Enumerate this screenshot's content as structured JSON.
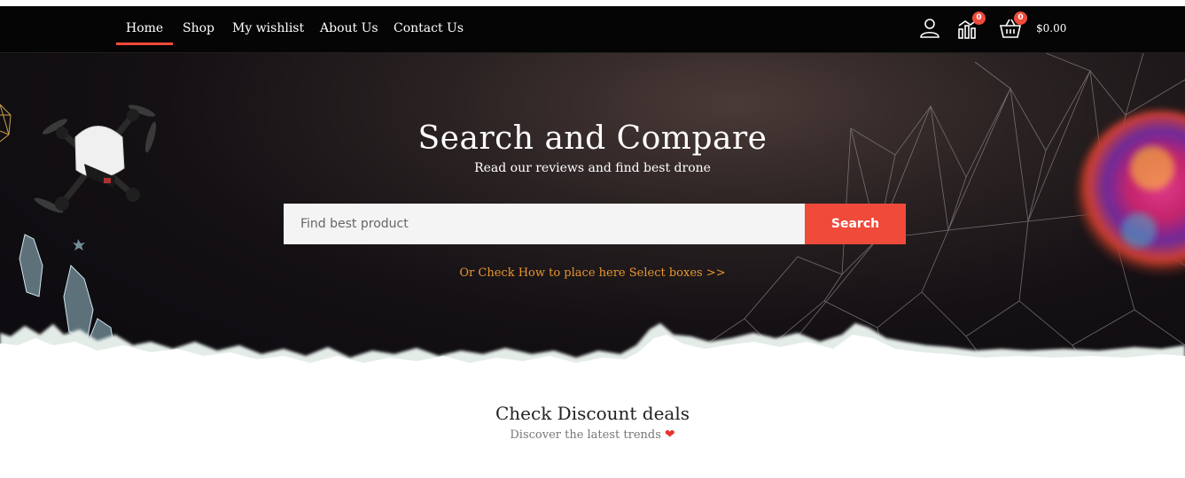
{
  "nav": {
    "items": [
      {
        "label": "Home",
        "active": true
      },
      {
        "label": "Shop"
      },
      {
        "label": "My wishlist"
      },
      {
        "label": "About Us"
      },
      {
        "label": "Contact Us"
      }
    ],
    "icons": {
      "account": "user-icon",
      "compare": "compare-chart-icon",
      "cart": "basket-icon"
    },
    "compare_count": "0",
    "cart_count": "0",
    "cart_total": "$0.00"
  },
  "hero": {
    "title": "Search and Compare",
    "subtitle": "Read our reviews and find best drone",
    "search_placeholder": "Find best product",
    "search_button": "Search",
    "link_text": "Or Check How to place here Select boxes >>"
  },
  "deals": {
    "title": "Check Discount deals",
    "subtitle": "Discover the latest trends"
  },
  "colors": {
    "accent": "#f04a3a",
    "link": "#e8962e",
    "nav_bg": "#050505"
  }
}
